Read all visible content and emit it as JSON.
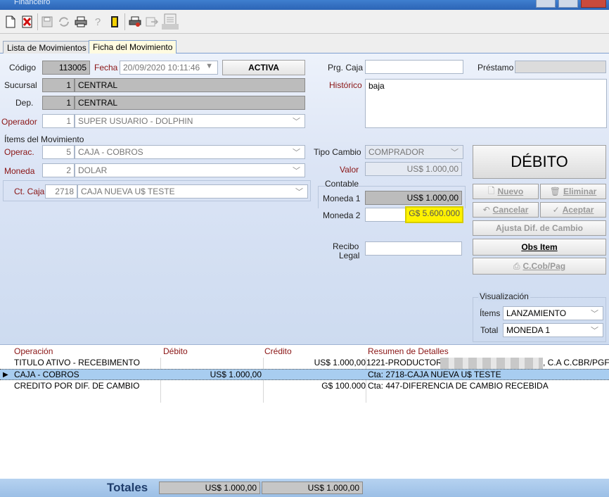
{
  "window": {
    "title": "Financeiro"
  },
  "toolbar": {
    "json_label": "JSON"
  },
  "tabs": [
    {
      "label": "Lista de Movimientos"
    },
    {
      "label": "Ficha del Movimiento"
    }
  ],
  "header": {
    "codigo_label": "Código",
    "codigo_value": "113005",
    "fecha_label": "Fecha",
    "fecha_value": "20/09/2020 10:11:46",
    "status": "ACTIVA",
    "sucursal_label": "Sucursal",
    "sucursal_num": "1",
    "sucursal_name": "CENTRAL",
    "dep_label": "Dep.",
    "dep_num": "1",
    "dep_name": "CENTRAL",
    "operador_label": "Operador",
    "operador_num": "1",
    "operador_name": "SUPER USUARIO - DOLPHIN"
  },
  "right_top": {
    "prg_caja_label": "Prg. Caja",
    "prg_caja_value": "",
    "prestamo_label": "Préstamo",
    "prestamo_value": "",
    "historico_label": "Histórico",
    "historico_value": "baja"
  },
  "items": {
    "section_label": "Ítems del Movimiento",
    "operac_label": "Operac.",
    "operac_num": "5",
    "operac_name": "CAJA - COBROS",
    "moneda_label": "Moneda",
    "moneda_num": "2",
    "moneda_name": "DOLAR",
    "ctcaja_label": "Ct. Caja",
    "ctcaja_num": "2718",
    "ctcaja_name": "CAJA NUEVA U$ TESTE"
  },
  "cambio": {
    "tipo_label": "Tipo Cambio",
    "tipo_value": "COMPRADOR",
    "valor_label": "Valor",
    "valor_value": "US$ 1.000,00",
    "contable_label": "Contable",
    "moneda1_label": "Moneda 1",
    "moneda1_value": "US$ 1.000,00",
    "moneda2_label": "Moneda 2",
    "moneda2_value": "G$ 5.600.000",
    "recibo_label_1": "Recibo",
    "recibo_label_2": "Legal",
    "recibo_value": ""
  },
  "actions": {
    "debito_label": "DÉBITO",
    "nuevo": "Nuevo",
    "eliminar": "Eliminar",
    "cancelar": "Cancelar",
    "aceptar": "Aceptar",
    "ajusta": "Ajusta Dif. de Cambio",
    "obs_item": "Obs Item",
    "ccob": "C.Cob/Pag"
  },
  "visualizacion": {
    "label": "Visualización",
    "items_label": "Ítems",
    "items_value": "LANZAMIENTO",
    "total_label": "Total",
    "total_value": "MONEDA 1"
  },
  "grid": {
    "headers": [
      "Operación",
      "Débito",
      "Crédito",
      "Resumen de Detalles"
    ],
    "rows": [
      {
        "operacion": "TITULO ATIVO - RECEBIMENTO",
        "debito": "",
        "credito": "US$ 1.000,00",
        "resumen": "1221-PRODUCTORA",
        "resumen_tail": ", C.A C.CBR/PGF"
      },
      {
        "operacion": "CAJA - COBROS",
        "debito": "US$ 1.000,00",
        "credito": "",
        "resumen": "Cta: 2718-CAJA NUEVA U$ TESTE",
        "resumen_tail": ""
      },
      {
        "operacion": "CREDITO POR DIF. DE CAMBIO",
        "debito": "",
        "credito": "G$ 100.000",
        "resumen": "Cta: 447-DIFERENCIA DE CAMBIO RECEBIDA",
        "resumen_tail": ""
      }
    ]
  },
  "totals": {
    "label": "Totales",
    "debito": "US$ 1.000,00",
    "credito": "US$ 1.000,00"
  }
}
